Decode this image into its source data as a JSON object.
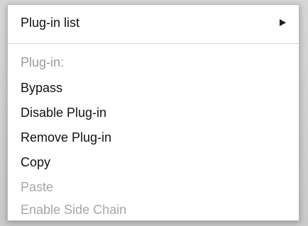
{
  "menu": {
    "submenu_label": "Plug-in list",
    "section_header": "Plug-in:",
    "items": [
      {
        "label": "Bypass",
        "enabled": true
      },
      {
        "label": "Disable Plug-in",
        "enabled": true
      },
      {
        "label": "Remove Plug-in",
        "enabled": true
      },
      {
        "label": "Copy",
        "enabled": true
      },
      {
        "label": "Paste",
        "enabled": false
      },
      {
        "label": "Enable Side Chain",
        "enabled": false
      }
    ]
  }
}
